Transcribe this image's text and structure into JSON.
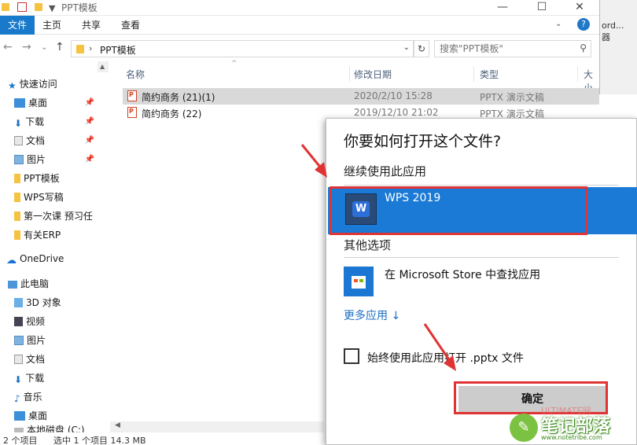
{
  "window": {
    "title": "PPT模板",
    "minimize_glyph": "—",
    "maximize_glyph": "☐",
    "close_glyph": "✕"
  },
  "ribbon": {
    "tabs": [
      "文件",
      "主页",
      "共享",
      "查看"
    ],
    "active_tab": "文件",
    "help_glyph": "?",
    "collapse_glyph": "⌄"
  },
  "nav": {
    "back_glyph": "←",
    "forward_glyph": "→",
    "recent_glyph": "⌄",
    "up_glyph": "↑",
    "path": "PPT模板",
    "refresh_glyph": "↻",
    "search_placeholder": "搜索\"PPT模板\""
  },
  "sliver": {
    "lines": [
      "ord...",
      "器"
    ]
  },
  "sidebar": {
    "quick_access": "快速访问",
    "items": [
      {
        "label": "桌面",
        "icon": "desktop-icon",
        "pinned": true
      },
      {
        "label": "下载",
        "icon": "download-icon",
        "pinned": true
      },
      {
        "label": "文档",
        "icon": "document-icon",
        "pinned": true
      },
      {
        "label": "图片",
        "icon": "picture-icon",
        "pinned": true
      },
      {
        "label": "PPT模板",
        "icon": "folder-icon",
        "pinned": false
      },
      {
        "label": "WPS写稿",
        "icon": "folder-icon",
        "pinned": false
      },
      {
        "label": "第一次课 预习任",
        "icon": "folder-icon",
        "pinned": false
      },
      {
        "label": "有关ERP",
        "icon": "folder-icon",
        "pinned": false
      }
    ],
    "onedrive": "OneDrive",
    "this_pc": "此电脑",
    "pc_items": [
      {
        "label": "3D 对象",
        "icon": "3d-objects-icon"
      },
      {
        "label": "视频",
        "icon": "video-icon"
      },
      {
        "label": "图片",
        "icon": "picture-icon"
      },
      {
        "label": "文档",
        "icon": "document-icon"
      },
      {
        "label": "下载",
        "icon": "download-icon"
      },
      {
        "label": "音乐",
        "icon": "music-icon"
      },
      {
        "label": "桌面",
        "icon": "desktop-icon"
      },
      {
        "label": "本地磁盘 (C:)",
        "icon": "disk-icon"
      }
    ]
  },
  "file_list": {
    "columns": [
      "名称",
      "修改日期",
      "类型",
      "大小"
    ],
    "rows": [
      {
        "name": "简约商务 (21)(1)",
        "date": "2020/2/10 15:28",
        "type": "PPTX 演示文稿",
        "selected": true
      },
      {
        "name": "简约商务 (22)",
        "date": "2019/12/10 21:02",
        "type": "PPTX 演示文稿",
        "selected": false
      }
    ]
  },
  "status": {
    "count": "2 个项目",
    "selection": "选中 1 个项目  14.3 MB"
  },
  "dialog": {
    "title": "你要如何打开这个文件?",
    "keep_using": "继续使用此应用",
    "wps_app": "WPS 2019",
    "wps_icon_letter": "W",
    "other_options": "其他选项",
    "store_option": "在 Microsoft Store 中查找应用",
    "more_apps": "更多应用 ↓",
    "always_use": "始终使用此应用打开 .pptx 文件",
    "ok": "确定",
    "accent": "#1a7ad6",
    "highlight": "#e03333"
  },
  "watermark": {
    "main": "笔记部落",
    "url": "www.notetribe.com",
    "top": "ULTIMATE网"
  }
}
